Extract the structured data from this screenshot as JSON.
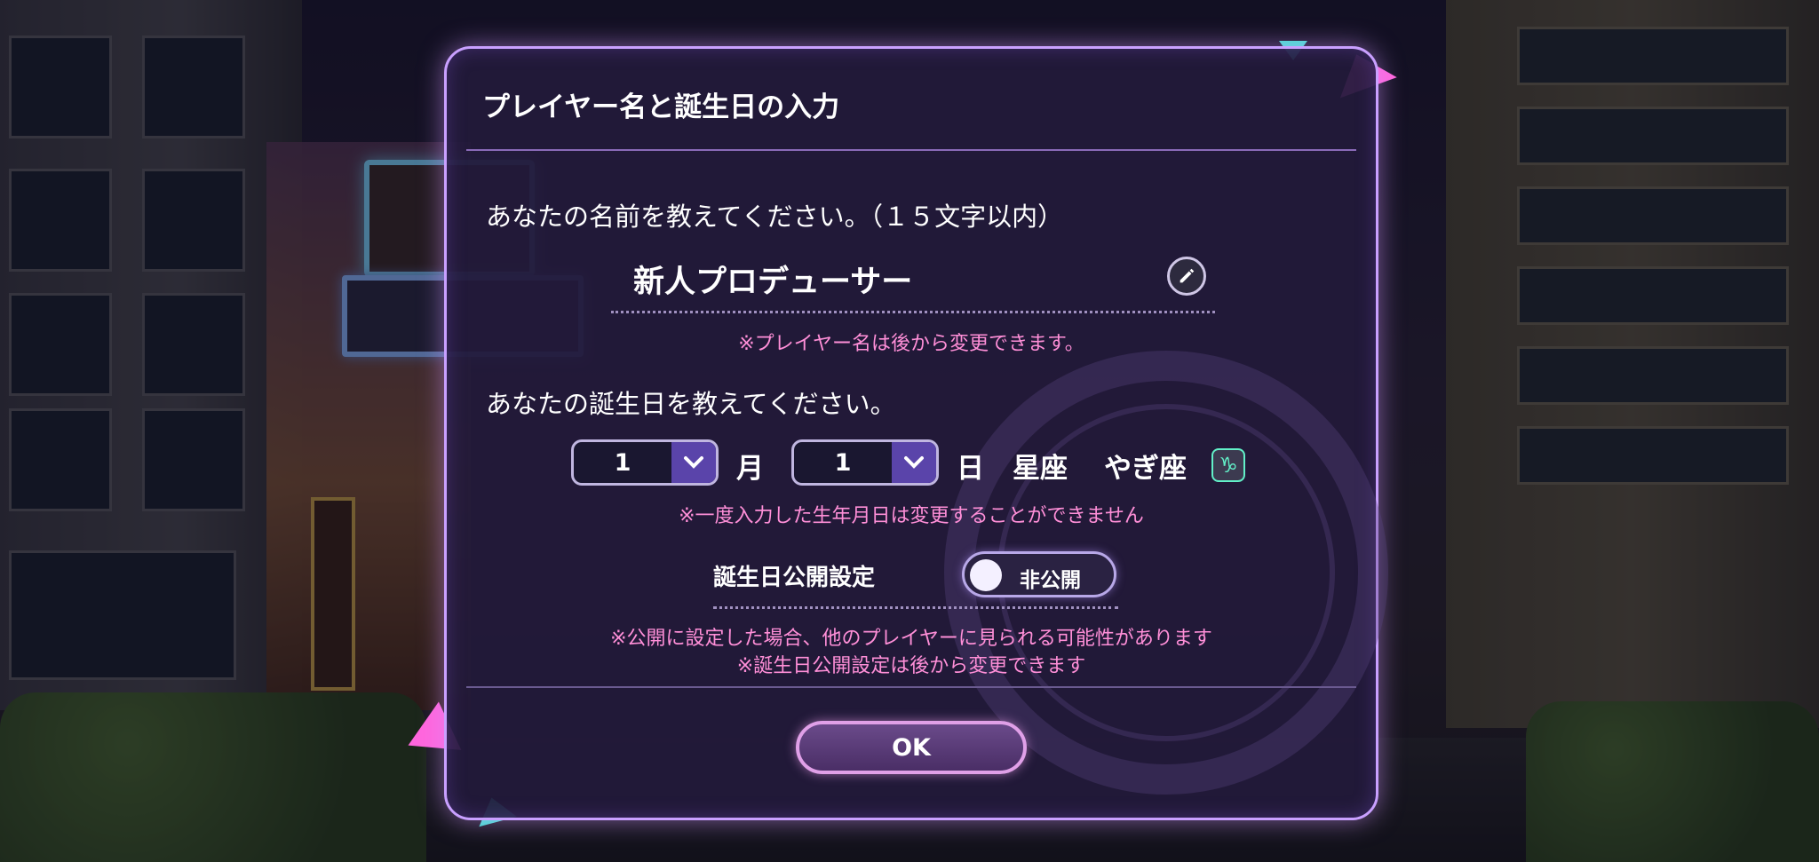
{
  "dialog": {
    "title": "プレイヤー名と誕生日の入力",
    "name_prompt": "あなたの名前を教えてください。（１５文字以内）",
    "name_value": "新人プロデューサー",
    "name_note": "※プレイヤー名は後から変更できます。",
    "birthday_prompt": "あなたの誕生日を教えてください。",
    "month_value": "1",
    "month_unit": "月",
    "day_value": "1",
    "day_unit": "日",
    "zodiac_label": "星座",
    "zodiac_value": "やぎ座",
    "zodiac_icon": "capricorn-icon",
    "birthday_note": "※一度入力した生年月日は変更することができません",
    "public_setting_label": "誕生日公開設定",
    "public_toggle_value": "非公開",
    "public_note_1": "※公開に設定した場合、他のプレイヤーに見られる可能性があります",
    "public_note_2": "※誕生日公開設定は後から変更できます",
    "ok_label": "OK"
  },
  "colors": {
    "accent": "#c9a0ff",
    "note_pink": "#ff8fd8",
    "select_arrow": "#5a44aa",
    "zodiac_border": "#62f0c8"
  }
}
